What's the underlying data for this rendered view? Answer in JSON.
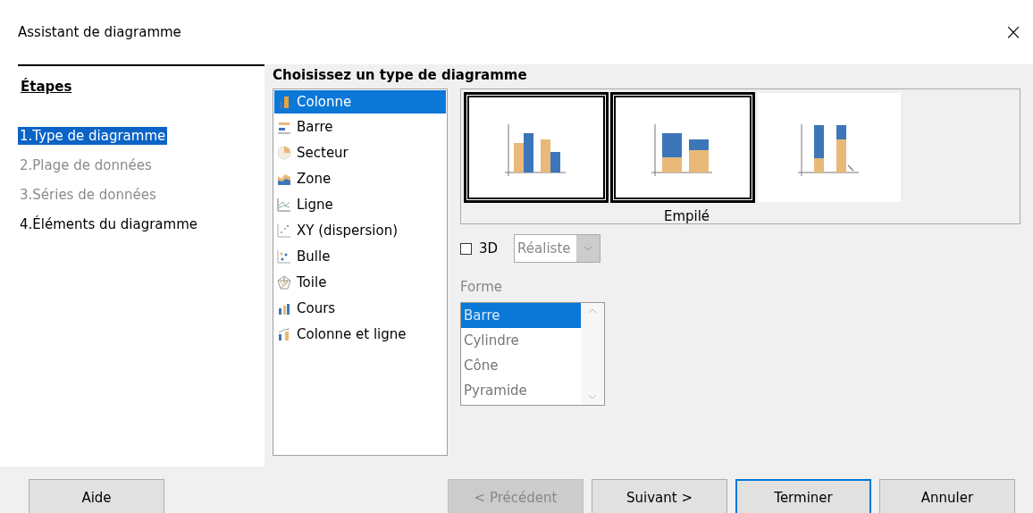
{
  "window": {
    "title": "Assistant de diagramme",
    "close": "×"
  },
  "steps": {
    "heading": "Étapes",
    "items": [
      {
        "label": "1.Type de diagramme",
        "selected": true,
        "disabled": false
      },
      {
        "label": "2.Plage de données",
        "selected": false,
        "disabled": true
      },
      {
        "label": "3.Séries de données",
        "selected": false,
        "disabled": true
      },
      {
        "label": "4.Éléments du diagramme",
        "selected": false,
        "disabled": false
      }
    ]
  },
  "heading": "Choisissez un type de diagramme",
  "chart_types": [
    {
      "label": "Colonne",
      "kind": "column",
      "selected": true
    },
    {
      "label": "Barre",
      "kind": "bar",
      "selected": false
    },
    {
      "label": "Secteur",
      "kind": "pie",
      "selected": false
    },
    {
      "label": "Zone",
      "kind": "area",
      "selected": false
    },
    {
      "label": "Ligne",
      "kind": "line",
      "selected": false
    },
    {
      "label": "XY (dispersion)",
      "kind": "scatter",
      "selected": false
    },
    {
      "label": "Bulle",
      "kind": "bubble",
      "selected": false
    },
    {
      "label": "Toile",
      "kind": "net",
      "selected": false
    },
    {
      "label": "Cours",
      "kind": "stock",
      "selected": false
    },
    {
      "label": "Colonne et ligne",
      "kind": "columnline",
      "selected": false
    }
  ],
  "variants": [
    {
      "kind": "normal",
      "framed": true
    },
    {
      "kind": "stacked",
      "framed": true
    },
    {
      "kind": "percent",
      "framed": false
    }
  ],
  "variant_caption": "Empilé",
  "three_d": {
    "label": "3D",
    "checked": false
  },
  "scheme_dropdown": {
    "value": "Réaliste",
    "disabled": true
  },
  "shape": {
    "label": "Forme",
    "disabled": true,
    "items": [
      {
        "label": "Barre",
        "selected": true
      },
      {
        "label": "Cylindre",
        "selected": false
      },
      {
        "label": "Cône",
        "selected": false
      },
      {
        "label": "Pyramide",
        "selected": false
      }
    ]
  },
  "buttons": [
    {
      "label": "Aide",
      "disabled": false,
      "focused": false
    },
    {
      "label": "< Précédent",
      "disabled": true,
      "focused": false
    },
    {
      "label": "Suivant >",
      "disabled": false,
      "focused": false
    },
    {
      "label": "Terminer",
      "disabled": false,
      "focused": true
    },
    {
      "label": "Annuler",
      "disabled": false,
      "focused": false
    }
  ]
}
